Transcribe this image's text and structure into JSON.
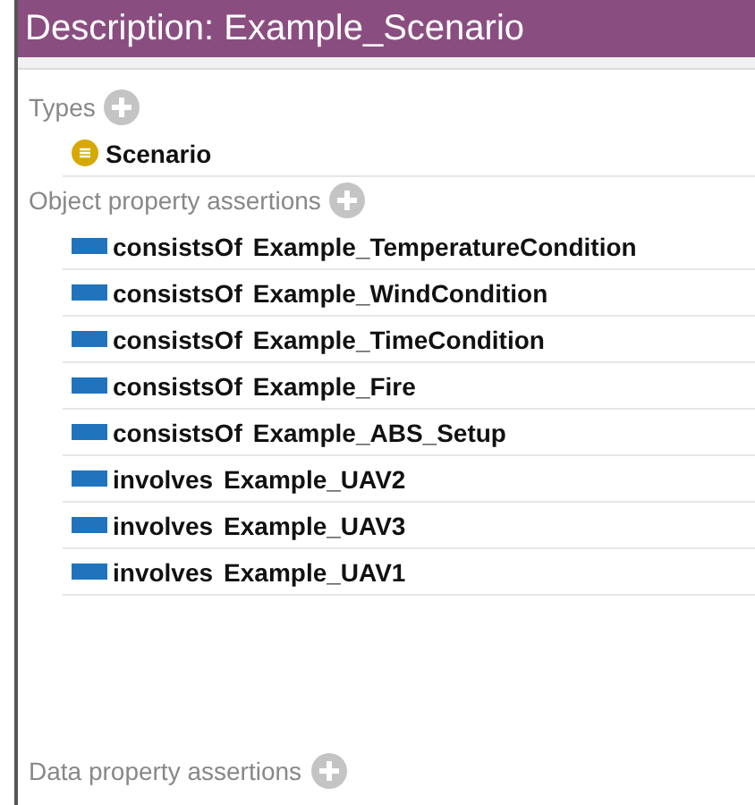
{
  "title": "Description: Example_Scenario",
  "sections": [
    {
      "label": "Types",
      "items": [
        {
          "kind": "class",
          "name": "Scenario"
        }
      ]
    },
    {
      "label": "Object property assertions",
      "items": [
        {
          "kind": "assertion",
          "property": "consistsOf",
          "value": "Example_TemperatureCondition"
        },
        {
          "kind": "assertion",
          "property": "consistsOf",
          "value": "Example_WindCondition"
        },
        {
          "kind": "assertion",
          "property": "consistsOf",
          "value": "Example_TimeCondition"
        },
        {
          "kind": "assertion",
          "property": "consistsOf",
          "value": "Example_Fire"
        },
        {
          "kind": "assertion",
          "property": "consistsOf",
          "value": "Example_ABS_Setup"
        },
        {
          "kind": "assertion",
          "property": "involves",
          "value": "Example_UAV2"
        },
        {
          "kind": "assertion",
          "property": "involves",
          "value": "Example_UAV3"
        },
        {
          "kind": "assertion",
          "property": "involves",
          "value": "Example_UAV1"
        }
      ]
    },
    {
      "label": "Data property assertions"
    }
  ]
}
